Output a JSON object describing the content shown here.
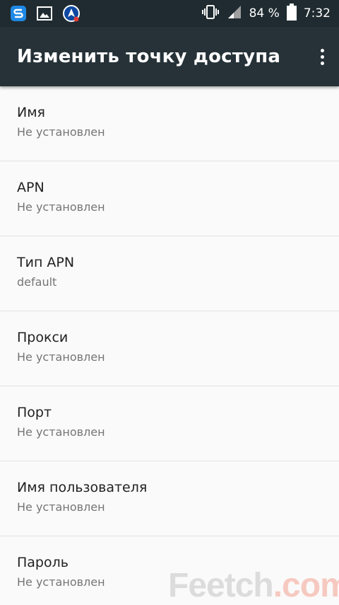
{
  "status_bar": {
    "left_icons": [
      "s-app-icon",
      "gallery-icon",
      "navigation-app-icon"
    ],
    "battery_percent": "84 %",
    "time": "7:32",
    "battery_level": 0.84
  },
  "app_bar": {
    "title": "Изменить точку доступа",
    "menu_icon": "more-vert-icon"
  },
  "fields": [
    {
      "title": "Имя",
      "summary": "Не установлен"
    },
    {
      "title": "APN",
      "summary": "Не установлен"
    },
    {
      "title": "Тип APN",
      "summary": "default"
    },
    {
      "title": "Прокси",
      "summary": "Не установлен"
    },
    {
      "title": "Порт",
      "summary": "Не установлен"
    },
    {
      "title": "Имя пользователя",
      "summary": "Не установлен"
    },
    {
      "title": "Пароль",
      "summary": "Не установлен"
    }
  ],
  "watermark": {
    "part1": "Feetch",
    "part2": ".com"
  },
  "colors": {
    "status_bar": "#1f2b30",
    "app_bar": "#263238",
    "background": "#fafafa",
    "s_app_blue": "#1e88e5",
    "badge_red": "#e53935"
  }
}
